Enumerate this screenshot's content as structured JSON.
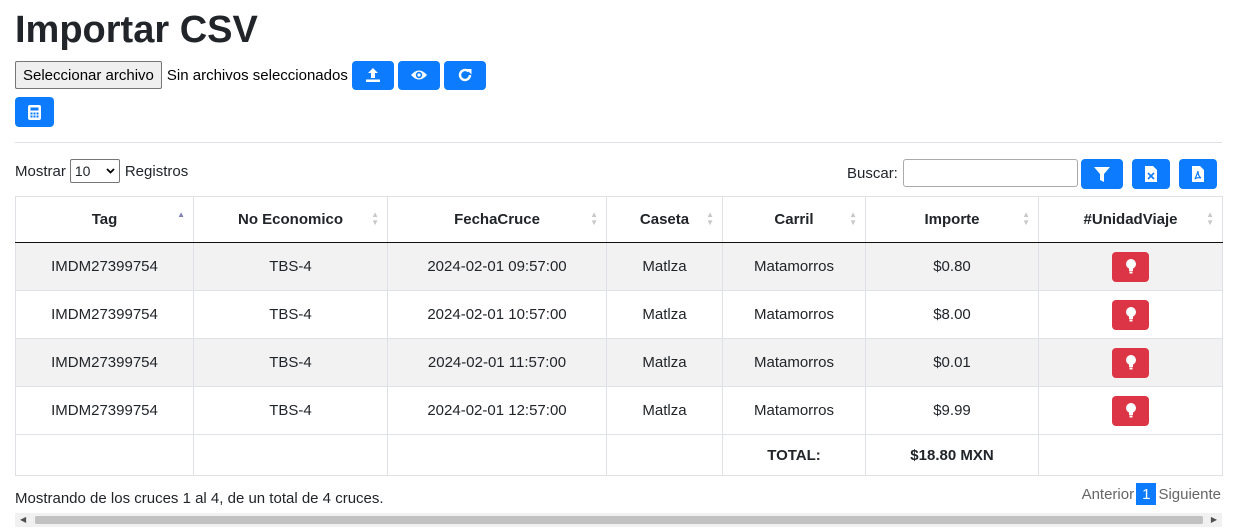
{
  "page": {
    "title": "Importar CSV"
  },
  "file_input": {
    "button_label": "Seleccionar archivo",
    "status_text": "Sin archivos seleccionados"
  },
  "toolbar": {
    "upload_icon": "upload-icon",
    "view_icon": "eye-icon",
    "refresh_icon": "refresh-icon",
    "calculator_icon": "calculator-icon"
  },
  "length_control": {
    "prefix": "Mostrar",
    "value": "10",
    "suffix": "Registros"
  },
  "search": {
    "label": "Buscar:",
    "value": "",
    "filter_icon": "filter-icon",
    "excel_icon": "excel-file-icon",
    "pdf_icon": "pdf-file-icon"
  },
  "table": {
    "columns": [
      "Tag",
      "No Economico",
      "FechaCruce",
      "Caseta",
      "Carril",
      "Importe",
      "#UnidadViaje"
    ],
    "rows": [
      {
        "tag": "IMDM27399754",
        "no_economico": "TBS-4",
        "fecha": "2024-02-01 09:57:00",
        "caseta": "Matlza",
        "carril": "Matamorros",
        "importe": "$0.80"
      },
      {
        "tag": "IMDM27399754",
        "no_economico": "TBS-4",
        "fecha": "2024-02-01 10:57:00",
        "caseta": "Matlza",
        "carril": "Matamorros",
        "importe": "$8.00"
      },
      {
        "tag": "IMDM27399754",
        "no_economico": "TBS-4",
        "fecha": "2024-02-01 11:57:00",
        "caseta": "Matlza",
        "carril": "Matamorros",
        "importe": "$0.01"
      },
      {
        "tag": "IMDM27399754",
        "no_economico": "TBS-4",
        "fecha": "2024-02-01 12:57:00",
        "caseta": "Matlza",
        "carril": "Matamorros",
        "importe": "$9.99"
      }
    ],
    "row_action_icon": "lightbulb-icon",
    "footer": {
      "total_label": "TOTAL:",
      "total_value": "$18.80 MXN"
    }
  },
  "info_text": "Mostrando de los cruces 1 al 4, de un total de 4 cruces.",
  "pagination": {
    "previous": "Anterior",
    "current_page": "1",
    "next": "Siguiente"
  },
  "colors": {
    "primary": "#0d7bfd",
    "danger": "#dc3545"
  }
}
